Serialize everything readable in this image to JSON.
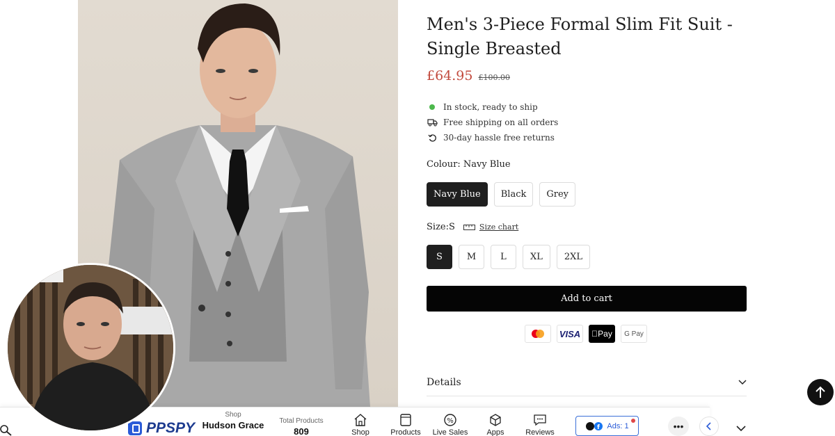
{
  "product": {
    "title": "Men's 3-Piece Formal Slim Fit Suit - Single Breasted",
    "price": "£64.95",
    "compare_price": "£100.00",
    "features": [
      {
        "icon": "green-dot-icon",
        "text": "In stock, ready to ship"
      },
      {
        "icon": "truck-icon",
        "text": "Free shipping on all orders"
      },
      {
        "icon": "return-arrow-icon",
        "text": "30-day hassle free returns"
      }
    ],
    "colour_label": "Colour: Navy Blue",
    "colours": [
      "Navy Blue",
      "Black",
      "Grey"
    ],
    "selected_colour": "Navy Blue",
    "size_label": "Size:S",
    "size_chart_label": "Size chart",
    "sizes": [
      "S",
      "M",
      "L",
      "XL",
      "2XL"
    ],
    "selected_size": "S",
    "add_to_cart": "Add to cart",
    "payments": [
      "mastercard-icon",
      "VISA",
      "apple-pay-icon",
      "google-pay-icon"
    ],
    "apple_pay_label": "Pay",
    "google_pay_label": "G Pay",
    "details_label": "Details"
  },
  "ppspy": {
    "logo_text": "PPSPY",
    "shop_label": "Shop",
    "shop_name": "Hudson Grace",
    "total_label": "Total Products",
    "total_value": "809",
    "nav": [
      {
        "icon": "shop-icon",
        "label": "Shop"
      },
      {
        "icon": "products-icon",
        "label": "Products"
      },
      {
        "icon": "live-sales-icon",
        "label": "Live Sales"
      },
      {
        "icon": "apps-icon",
        "label": "Apps"
      },
      {
        "icon": "reviews-icon",
        "label": "Reviews"
      }
    ],
    "ads_label": "Ads: 1",
    "more_label": "•••"
  },
  "colors": {
    "accent_price": "#c24a3d",
    "button_dark": "#050505",
    "in_stock": "#4cb84c",
    "ppspy_blue": "#2a5bd7"
  }
}
